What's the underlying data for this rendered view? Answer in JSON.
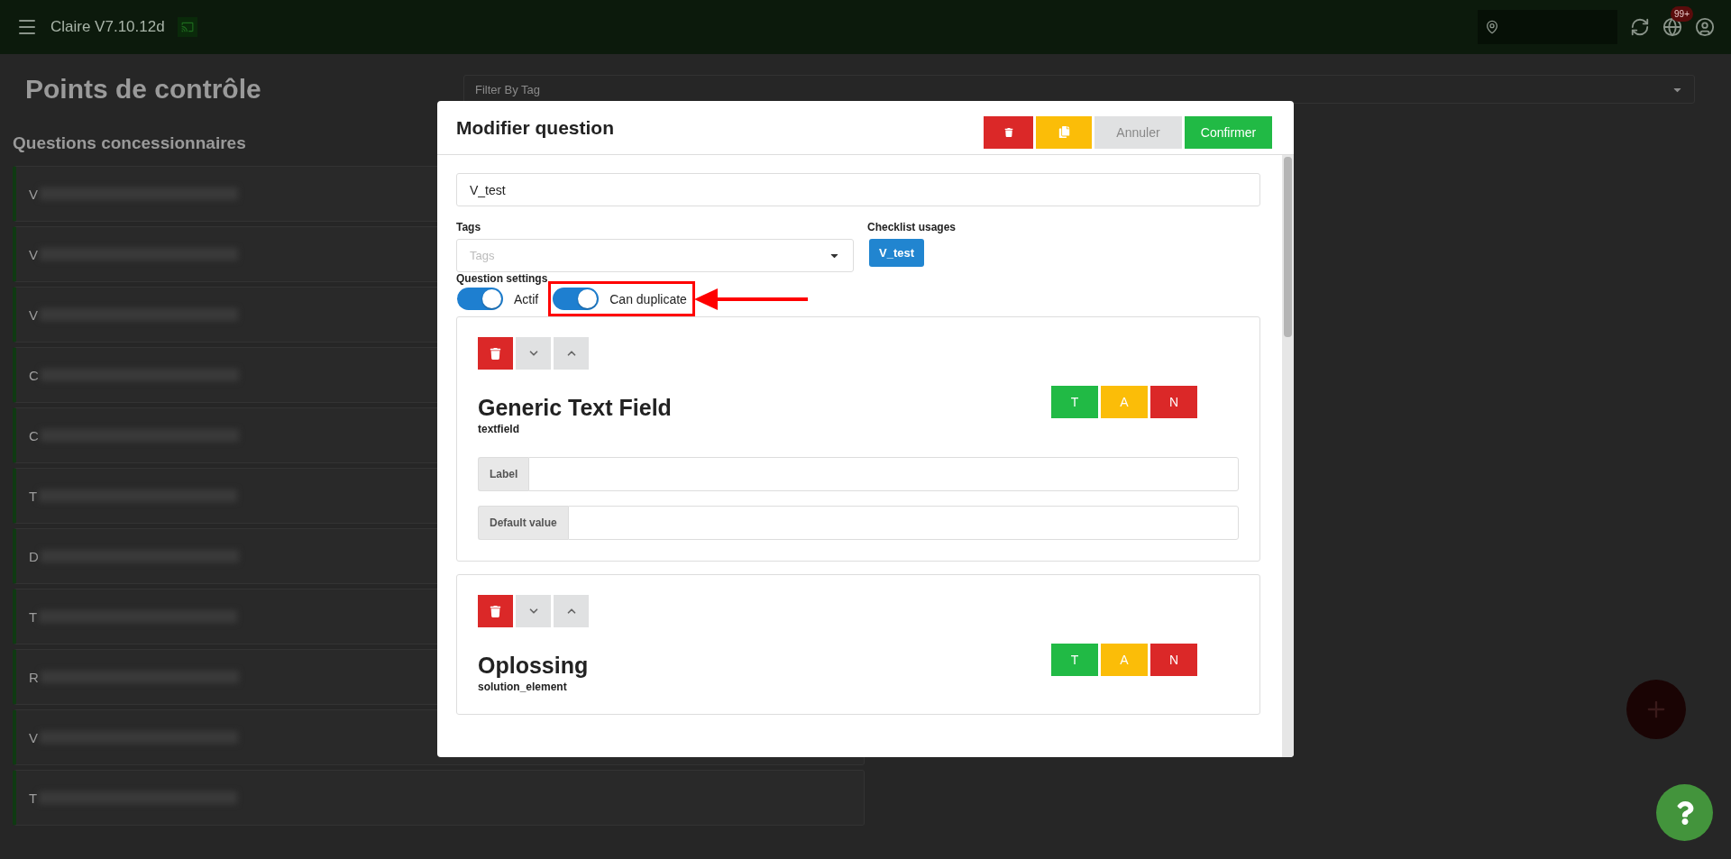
{
  "top_bar": {
    "app_name": "Claire V7.10.12d",
    "notification_badge": "99+"
  },
  "page": {
    "title": "Points de contrôle",
    "filter": {
      "placeholder": "Filter By Tag"
    },
    "section_title": "Questions concessionnaires",
    "items": [
      {
        "label": "V"
      },
      {
        "label": "V"
      },
      {
        "label": "V"
      },
      {
        "label": "C"
      },
      {
        "label": "C"
      },
      {
        "label": "T"
      },
      {
        "label": "D"
      },
      {
        "label": "T"
      },
      {
        "label": "R"
      },
      {
        "label": "V"
      },
      {
        "label": "T"
      }
    ]
  },
  "modal": {
    "title": "Modifier question",
    "actions": [
      {
        "kind": "delete"
      },
      {
        "kind": "duplicate"
      },
      {
        "kind": "cancel",
        "label": "Annuler"
      },
      {
        "kind": "confirm",
        "label": "Confirmer"
      }
    ],
    "name_field": {
      "value": "V_test"
    },
    "tags": {
      "label": "Tags",
      "placeholder": "Tags"
    },
    "checklist_usages": {
      "label": "Checklist usages",
      "chips": [
        "V_test"
      ]
    },
    "settings": {
      "label": "Question settings",
      "toggles": [
        {
          "label": "Actif",
          "on": true,
          "highlighted": false
        },
        {
          "label": "Can duplicate",
          "on": true,
          "highlighted": true
        }
      ]
    },
    "elements": [
      {
        "title": "Generic Text Field",
        "type": "textfield",
        "ratings": [
          {
            "label": "T",
            "color": "#21ba45"
          },
          {
            "label": "A",
            "color": "#fbbd08"
          },
          {
            "label": "N",
            "color": "#db2828"
          }
        ],
        "fields": [
          {
            "label": "Label"
          },
          {
            "label": "Default value"
          }
        ]
      },
      {
        "title": "Oplossing",
        "type": "solution_element",
        "ratings": [
          {
            "label": "T",
            "color": "#21ba45"
          },
          {
            "label": "A",
            "color": "#fbbd08"
          },
          {
            "label": "N",
            "color": "#db2828"
          }
        ]
      }
    ]
  }
}
